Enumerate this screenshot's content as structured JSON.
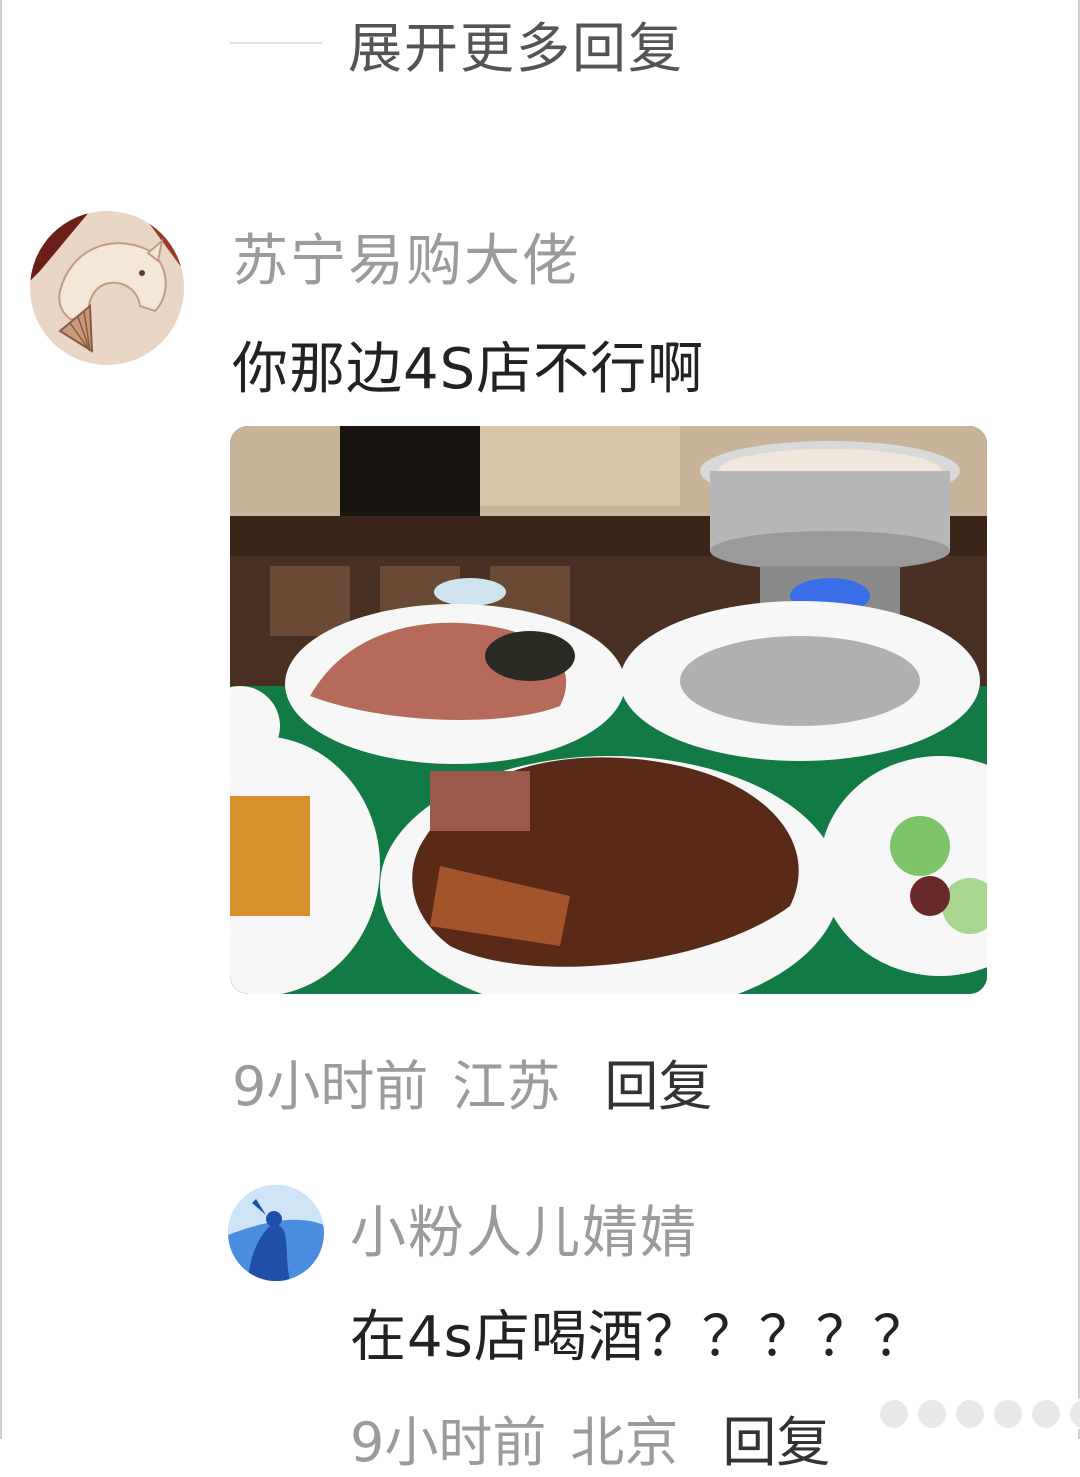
{
  "thread": {
    "expand_more_replies": "展开更多回复"
  },
  "comments": [
    {
      "username": "苏宁易购大佬",
      "text": "你那边4S店不行啊",
      "time": "9小时前",
      "location": "江苏",
      "reply_label": "回复",
      "avatar_icon": "horse-fan-avatar-icon",
      "image": "dinner-table-photo"
    },
    {
      "username": "小粉人儿婧婧",
      "text": "在4s店喝酒？？？？？",
      "time": "9小时前",
      "location": "北京",
      "reply_label": "回复",
      "avatar_icon": "blue-figure-avatar-icon"
    }
  ],
  "colors": {
    "username": "#9b9b9b",
    "text": "#222222",
    "meta": "#9b9b9b",
    "reply": "#333333"
  }
}
